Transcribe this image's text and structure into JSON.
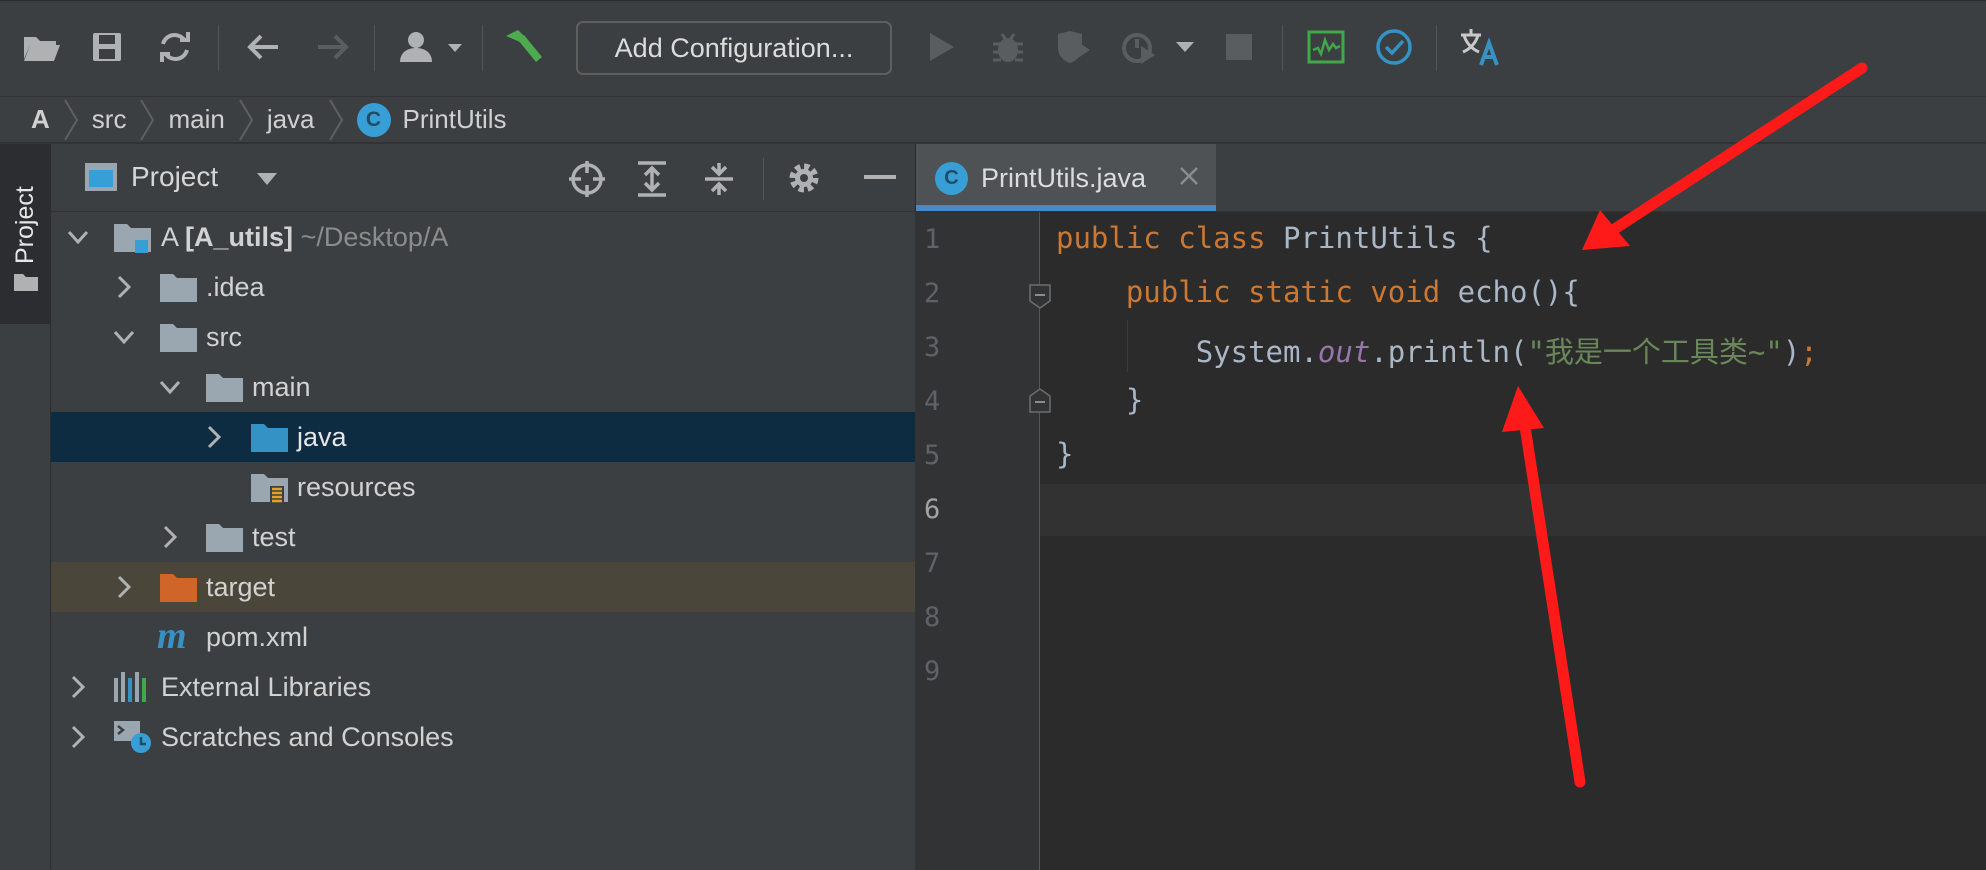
{
  "toolbar": {
    "icons": [
      "open-folder-icon",
      "save-icon",
      "sync-icon",
      "back-arrow-icon",
      "forward-arrow-icon",
      "user-dropdown-icon",
      "build-hammer-icon",
      "run-icon",
      "debug-icon",
      "coverage-icon",
      "profile-icon",
      "run-dropdown-icon",
      "stop-icon",
      "monitor-icon",
      "check-icon",
      "translate-icon"
    ],
    "add_configuration": "Add Configuration..."
  },
  "breadcrumb": {
    "items": [
      "A",
      "src",
      "main",
      "java"
    ],
    "class_badge": "C",
    "current": "PrintUtils"
  },
  "sidebar": {
    "tab_label": "Project"
  },
  "project_panel": {
    "title": "Project",
    "root": {
      "name": "A",
      "module": "[A_utils]",
      "path": "~/Desktop/A"
    },
    "items": [
      ".idea",
      "src",
      "main",
      "java",
      "resources",
      "test",
      "target",
      "pom.xml",
      "External Libraries",
      "Scratches and Consoles"
    ],
    "pom_badge": "m"
  },
  "editor": {
    "tab_badge": "C",
    "tab_label": "PrintUtils.java",
    "line_numbers": [
      "1",
      "2",
      "3",
      "4",
      "5",
      "6",
      "7",
      "8",
      "9"
    ],
    "current_line": 6,
    "code": {
      "l1_public": "public",
      "l1_class": "class",
      "l1_name": "PrintUtils",
      "l1_brace": "{",
      "l2_public": "public",
      "l2_static": "static",
      "l2_void": "void",
      "l2_name": "echo",
      "l2_rest": "(){",
      "l3_system": "System.",
      "l3_out": "out",
      "l3_println": ".println(",
      "l3_string": "\"我是一个工具类~\"",
      "l3_close": ")",
      "l3_semicolon": ";",
      "l4_brace": "}",
      "l5_brace": "}"
    }
  },
  "colors": {
    "keyword": "#cc7832",
    "string": "#6a8759",
    "static_field": "#9876aa",
    "selection": "#0d2b41",
    "annotation_arrow": "#ff1a1a"
  }
}
